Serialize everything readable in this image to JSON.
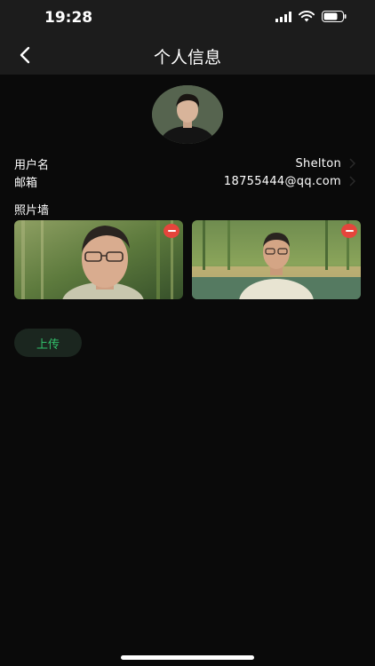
{
  "status_bar": {
    "time": "19:28",
    "icons": [
      "signal-icon",
      "wifi-icon",
      "battery-icon"
    ]
  },
  "nav": {
    "back_icon": "chevron-left-icon",
    "title": "个人信息"
  },
  "profile": {
    "avatar": "avatar-icon",
    "fields": [
      {
        "label": "用户名",
        "value": "Shelton"
      },
      {
        "label": "邮箱",
        "value": "18755444@qq.com"
      }
    ]
  },
  "photo_wall": {
    "title": "照片墙",
    "photos": [
      {
        "delete_icon": "minus-circle-icon"
      },
      {
        "delete_icon": "minus-circle-icon"
      }
    ]
  },
  "upload": {
    "label": "上传"
  },
  "colors": {
    "background": "#0a0a0a",
    "bar": "#1c1c1c",
    "accent_green": "#32c06b",
    "delete_red": "#e5453c"
  }
}
